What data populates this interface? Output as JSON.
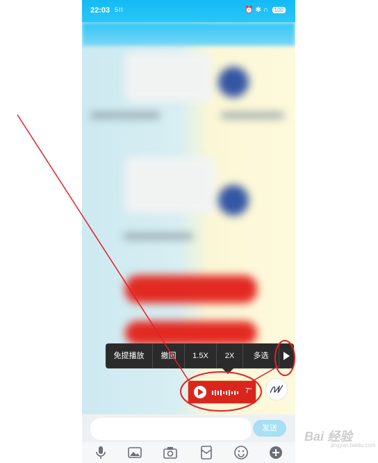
{
  "status_bar": {
    "time": "22:03",
    "signal": "5Il",
    "battery": "100"
  },
  "context_menu": {
    "items": [
      "免提播放",
      "撤回",
      "1.5X",
      "2X",
      "多选"
    ],
    "more_icon": "play-triangle-icon"
  },
  "voice_message": {
    "duration": "7\"",
    "color": "#d9261c"
  },
  "input_bar": {
    "placeholder": "",
    "send_label": "发送"
  },
  "toolbar": {
    "icons": [
      "microphone-icon",
      "image-icon",
      "camera-icon",
      "red-packet-icon",
      "emoji-icon",
      "plus-icon"
    ]
  },
  "annotation_color": "#e0202a",
  "watermark": {
    "text": "Bai",
    "text2": "经验",
    "sub": "jingyan.baidu.com"
  }
}
